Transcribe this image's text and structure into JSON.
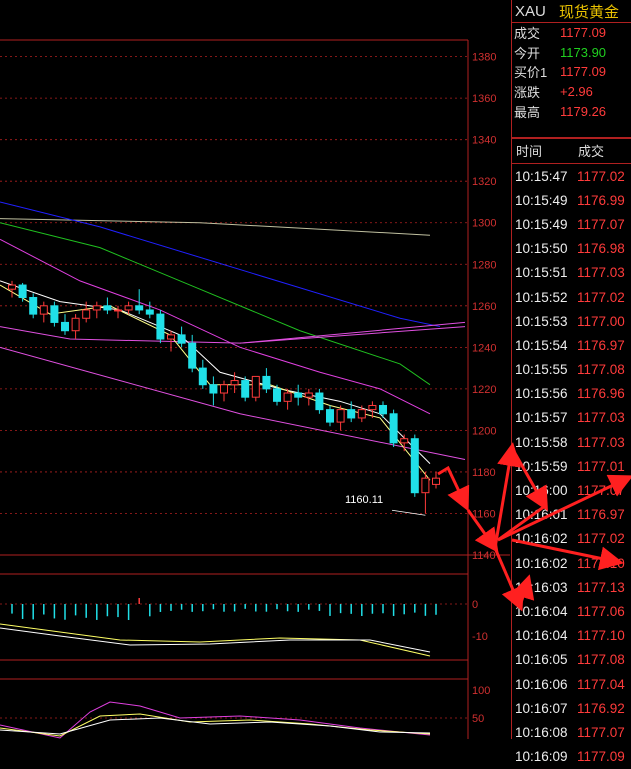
{
  "quote": {
    "symbol": "XAU",
    "name": "现货黄金",
    "rows": [
      {
        "label": "成交",
        "value": "1177.09",
        "color": "red"
      },
      {
        "label": "今开",
        "value": "1173.90",
        "color": "green"
      },
      {
        "label": "买价1",
        "value": "1177.09",
        "color": "red"
      },
      {
        "label": "涨跌",
        "value": "+2.96",
        "color": "red"
      },
      {
        "label": "最高",
        "value": "1179.26",
        "color": "red"
      }
    ]
  },
  "ticks": {
    "headers": [
      "时间",
      "成交"
    ],
    "rows": [
      [
        "10:15:47",
        "1177.02"
      ],
      [
        "10:15:49",
        "1176.99"
      ],
      [
        "10:15:49",
        "1177.07"
      ],
      [
        "10:15:50",
        "1176.98"
      ],
      [
        "10:15:51",
        "1177.03"
      ],
      [
        "10:15:52",
        "1177.02"
      ],
      [
        "10:15:53",
        "1177.00"
      ],
      [
        "10:15:54",
        "1176.97"
      ],
      [
        "10:15:55",
        "1177.08"
      ],
      [
        "10:15:56",
        "1176.96"
      ],
      [
        "10:15:57",
        "1177.03"
      ],
      [
        "10:15:58",
        "1177.03"
      ],
      [
        "10:15:59",
        "1177.01"
      ],
      [
        "10:16:00",
        "1177.07"
      ],
      [
        "10:16:01",
        "1176.97"
      ],
      [
        "10:16:02",
        "1177.02"
      ],
      [
        "10:16:02",
        "1177.10"
      ],
      [
        "10:16:03",
        "1177.13"
      ],
      [
        "10:16:04",
        "1177.06"
      ],
      [
        "10:16:04",
        "1177.10"
      ],
      [
        "10:16:05",
        "1177.08"
      ],
      [
        "10:16:06",
        "1177.04"
      ],
      [
        "10:16:07",
        "1176.92"
      ],
      [
        "10:16:08",
        "1177.07"
      ],
      [
        "10:16:09",
        "1177.09"
      ]
    ]
  },
  "chart_data": {
    "type": "candlestick",
    "price_axis": {
      "ticks": [
        1380,
        1360,
        1340,
        1320,
        1300,
        1280,
        1260,
        1240,
        1220,
        1200,
        1180,
        1160,
        1140
      ],
      "min": 1140,
      "max": 1390
    },
    "low_annotation": "1160.11",
    "macd_axis": {
      "ticks": [
        "0",
        "-10"
      ]
    },
    "kdj_axis": {
      "ticks": [
        "100",
        "50"
      ]
    },
    "candles": [
      [
        1268,
        1272,
        1264,
        1270
      ],
      [
        1270,
        1271,
        1262,
        1264
      ],
      [
        1264,
        1266,
        1254,
        1256
      ],
      [
        1256,
        1262,
        1252,
        1260
      ],
      [
        1260,
        1262,
        1250,
        1252
      ],
      [
        1252,
        1256,
        1246,
        1248
      ],
      [
        1248,
        1256,
        1244,
        1254
      ],
      [
        1254,
        1262,
        1252,
        1258
      ],
      [
        1258,
        1262,
        1254,
        1260
      ],
      [
        1260,
        1264,
        1256,
        1258
      ],
      [
        1258,
        1260,
        1254,
        1258
      ],
      [
        1258,
        1262,
        1256,
        1260
      ],
      [
        1260,
        1268,
        1256,
        1258
      ],
      [
        1258,
        1262,
        1254,
        1256
      ],
      [
        1256,
        1258,
        1242,
        1244
      ],
      [
        1244,
        1248,
        1238,
        1246
      ],
      [
        1246,
        1250,
        1240,
        1242
      ],
      [
        1242,
        1246,
        1228,
        1230
      ],
      [
        1230,
        1234,
        1220,
        1222
      ],
      [
        1222,
        1226,
        1212,
        1218
      ],
      [
        1218,
        1224,
        1214,
        1222
      ],
      [
        1222,
        1228,
        1218,
        1224
      ],
      [
        1224,
        1226,
        1214,
        1216
      ],
      [
        1216,
        1226,
        1214,
        1226
      ],
      [
        1226,
        1230,
        1218,
        1220
      ],
      [
        1220,
        1222,
        1212,
        1214
      ],
      [
        1214,
        1220,
        1210,
        1218
      ],
      [
        1218,
        1222,
        1212,
        1216
      ],
      [
        1216,
        1220,
        1212,
        1218
      ],
      [
        1218,
        1220,
        1208,
        1210
      ],
      [
        1210,
        1212,
        1202,
        1204
      ],
      [
        1204,
        1212,
        1200,
        1210
      ],
      [
        1210,
        1214,
        1204,
        1206
      ],
      [
        1206,
        1212,
        1204,
        1210
      ],
      [
        1210,
        1214,
        1206,
        1212
      ],
      [
        1212,
        1214,
        1206,
        1208
      ],
      [
        1208,
        1210,
        1192,
        1194
      ],
      [
        1194,
        1198,
        1190,
        1196
      ],
      [
        1196,
        1198,
        1168,
        1170
      ],
      [
        1170,
        1180,
        1160,
        1177
      ],
      [
        1174,
        1180,
        1172,
        1177
      ]
    ],
    "colors": {
      "up": "#ff3b3b",
      "down": "#20e0e8",
      "ma5": "#ffff88",
      "ma10": "#ffffff",
      "ma20": "#e040e0",
      "ma30": "#20c020",
      "ma60": "#2020ff",
      "ma120": "#c0c0a0",
      "channel": "#e050e0",
      "axis": "#b02020"
    }
  },
  "annotations": {
    "arrow_color": "#ff2020"
  }
}
